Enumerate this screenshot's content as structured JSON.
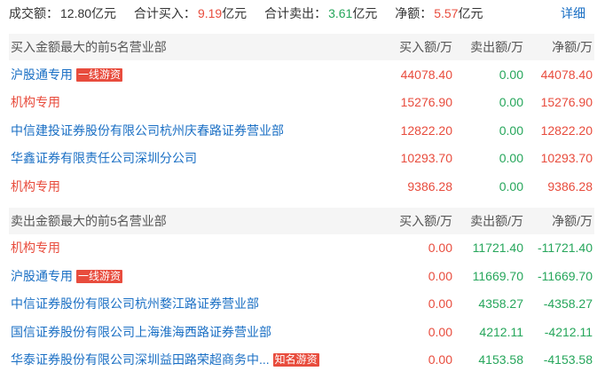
{
  "summary": {
    "turnover_label": "成交额：",
    "turnover_value": "12.80亿元",
    "buy_label": "合计买入：",
    "buy_value": "9.19",
    "buy_unit": "亿元",
    "sell_label": "合计卖出：",
    "sell_value": "3.61",
    "sell_unit": "亿元",
    "net_label": "净额：",
    "net_value": "5.57",
    "net_unit": "亿元",
    "detail_link": "详细"
  },
  "columns": {
    "buy": "买入额/万",
    "sell": "卖出额/万",
    "net": "净额/万"
  },
  "buy_section": {
    "title": "买入金额最大的前5名营业部",
    "rows": [
      {
        "name": "沪股通专用",
        "tag": "一线游资",
        "buy": "44078.40",
        "sell": "0.00",
        "net": "44078.40"
      },
      {
        "name": "机构专用",
        "tag": "",
        "buy": "15276.90",
        "sell": "0.00",
        "net": "15276.90"
      },
      {
        "name": "中信建投证券股份有限公司杭州庆春路证券营业部",
        "tag": "",
        "buy": "12822.20",
        "sell": "0.00",
        "net": "12822.20"
      },
      {
        "name": "华鑫证券有限责任公司深圳分公司",
        "tag": "",
        "buy": "10293.70",
        "sell": "0.00",
        "net": "10293.70"
      },
      {
        "name": "机构专用",
        "tag": "",
        "buy": "9386.28",
        "sell": "0.00",
        "net": "9386.28"
      }
    ]
  },
  "sell_section": {
    "title": "卖出金额最大的前5名营业部",
    "rows": [
      {
        "name": "机构专用",
        "tag": "",
        "buy": "0.00",
        "sell": "11721.40",
        "net": "-11721.40"
      },
      {
        "name": "沪股通专用",
        "tag": "一线游资",
        "buy": "0.00",
        "sell": "11669.70",
        "net": "-11669.70"
      },
      {
        "name": "中信证券股份有限公司杭州婺江路证券营业部",
        "tag": "",
        "buy": "0.00",
        "sell": "4358.27",
        "net": "-4358.27"
      },
      {
        "name": "国信证券股份有限公司上海淮海西路证券营业部",
        "tag": "",
        "buy": "0.00",
        "sell": "4212.11",
        "net": "-4212.11"
      },
      {
        "name": "华泰证券股份有限公司深圳益田路荣超商务中...",
        "tag": "知名游资",
        "buy": "0.00",
        "sell": "4153.58",
        "net": "-4153.58"
      }
    ]
  },
  "colors": {
    "up": "#e84c3d",
    "down": "#26a65b",
    "link": "#1a6fc4",
    "institution": "#e84c3d"
  }
}
